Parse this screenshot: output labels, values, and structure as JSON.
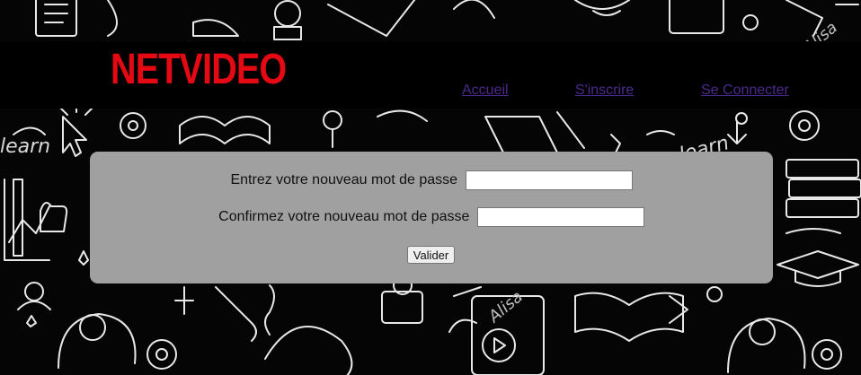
{
  "header": {
    "logo": "NETVIDEO",
    "nav": [
      {
        "label": "Accueil"
      },
      {
        "label": "S'inscrire"
      },
      {
        "label": "Se Connecter"
      }
    ]
  },
  "form": {
    "new_password_label": "Entrez votre nouveau mot de passe",
    "confirm_password_label": "Confirmez votre nouveau mot de passe",
    "new_password_value": "",
    "confirm_password_value": "",
    "submit_label": "Valider"
  },
  "background": {
    "words": [
      "learn",
      "learn",
      "Alisa",
      "Alisa"
    ]
  },
  "colors": {
    "brand": "#e50914",
    "link": "#4b2a8c",
    "panel": "#a0a0a0"
  }
}
